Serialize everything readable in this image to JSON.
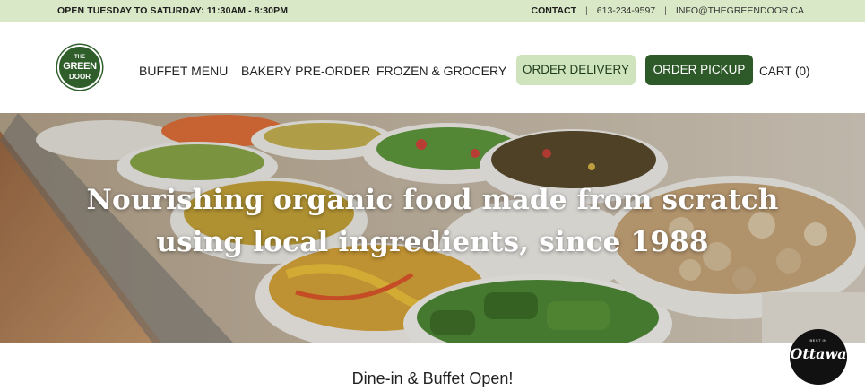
{
  "topbar": {
    "hours": "OPEN TUESDAY TO SATURDAY: 11:30AM - 8:30PM",
    "contact": "CONTACT",
    "phone": "613-234-9597",
    "email": "INFO@THEGREENDOOR.CA",
    "separator": "|"
  },
  "logo": {
    "line1": "THE",
    "line2": "GREEN",
    "line3": "DOOR"
  },
  "nav": {
    "items": [
      {
        "label": "BUFFET MENU"
      },
      {
        "label": "BAKERY PRE-ORDER"
      },
      {
        "label": "FROZEN & GROCERY"
      }
    ],
    "order_delivery": "ORDER DELIVERY",
    "order_pickup": "ORDER PICKUP",
    "cart": "CART (0)"
  },
  "hero": {
    "headline_line1": "Nourishing organic food made from scratch",
    "headline_line2": "using local ingredients, since 1988"
  },
  "main": {
    "subheading": "Dine-in & Buffet Open!"
  },
  "badge": {
    "small": "BEST IN",
    "big": "Ottawa"
  },
  "colors": {
    "topbar_bg": "#d9e8c6",
    "brand_green": "#2e5a2a",
    "light_green": "#cfe4bd"
  }
}
